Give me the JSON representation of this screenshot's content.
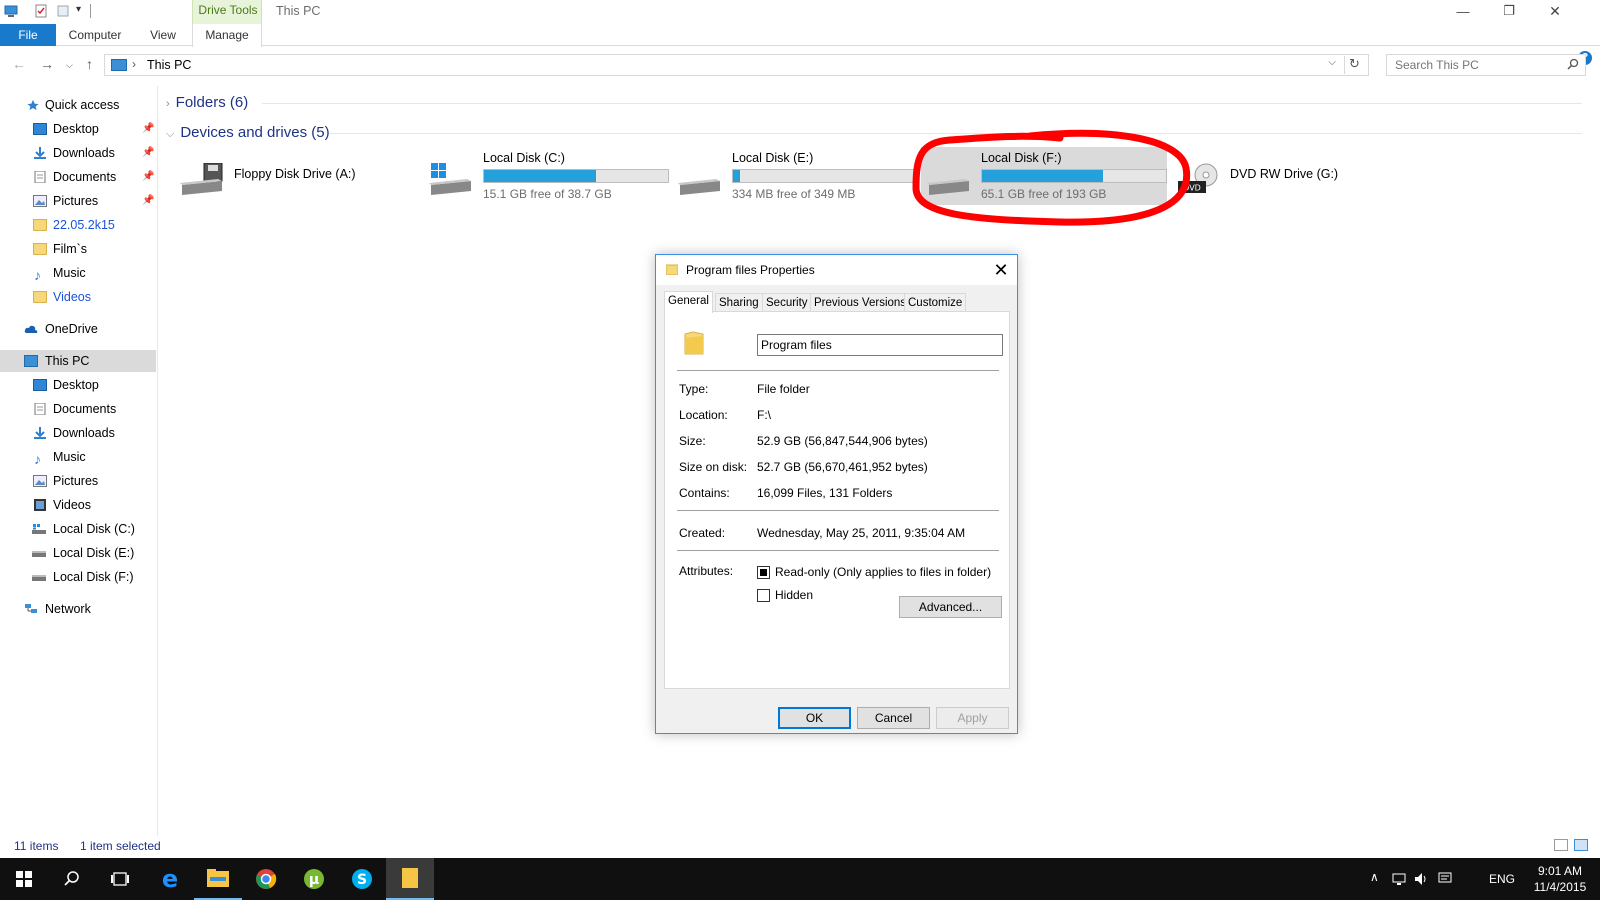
{
  "window": {
    "title": "This PC",
    "context_group": "Drive Tools",
    "minimize": "—",
    "restore": "❐",
    "close": "✕"
  },
  "ribbon": {
    "tabs": [
      "File",
      "Computer",
      "View",
      "Manage"
    ],
    "help": "?"
  },
  "address": {
    "path": "This PC",
    "search_placeholder": "Search This PC"
  },
  "nav": {
    "quick_access": "Quick access",
    "quick_items": [
      "Desktop",
      "Downloads",
      "Documents",
      "Pictures",
      "22.05.2k15",
      "Film`s",
      "Music",
      "Videos"
    ],
    "onedrive": "OneDrive",
    "this_pc": "This PC",
    "pc_items": [
      "Desktop",
      "Documents",
      "Downloads",
      "Music",
      "Pictures",
      "Videos",
      "Local Disk (C:)",
      "Local Disk (E:)",
      "Local Disk (F:)"
    ],
    "network": "Network"
  },
  "content": {
    "folders_header": "Folders (6)",
    "devices_header": "Devices and drives (5)",
    "drives": [
      {
        "name": "Floppy Disk Drive (A:)",
        "free": "",
        "used_fraction": null
      },
      {
        "name": "Local Disk (C:)",
        "free": "15.1 GB free of 38.7 GB",
        "used_fraction": 0.61
      },
      {
        "name": "Local Disk (E:)",
        "free": "334 MB free of 349 MB",
        "used_fraction": 0.04
      },
      {
        "name": "Local Disk (F:)",
        "free": "65.1 GB free of 193 GB",
        "used_fraction": 0.66
      },
      {
        "name": "DVD RW Drive (G:)",
        "free": "",
        "used_fraction": null
      }
    ]
  },
  "status": {
    "items": "11 items",
    "selected": "1 item selected"
  },
  "dialog": {
    "title": "Program files Properties",
    "close": "✕",
    "tabs": [
      "General",
      "Sharing",
      "Security",
      "Previous Versions",
      "Customize"
    ],
    "name": "Program files",
    "type_label": "Type:",
    "type_value": "File folder",
    "location_label": "Location:",
    "location_value": "F:\\",
    "size_label": "Size:",
    "size_value": "52.9 GB (56,847,544,906 bytes)",
    "size_on_disk_label": "Size on disk:",
    "size_on_disk_value": "52.7 GB (56,670,461,952 bytes)",
    "contains_label": "Contains:",
    "contains_value": "16,099 Files, 131 Folders",
    "created_label": "Created:",
    "created_value": "Wednesday, May 25, 2011, 9:35:04 AM",
    "attributes_label": "Attributes:",
    "readonly_label": "Read-only (Only applies to files in folder)",
    "readonly_checked": true,
    "hidden_label": "Hidden",
    "hidden_checked": false,
    "advanced_label": "Advanced...",
    "ok_label": "OK",
    "cancel_label": "Cancel",
    "apply_label": "Apply"
  },
  "taskbar": {
    "lang": "ENG",
    "time": "9:01 AM",
    "date": "11/4/2015"
  },
  "colors": {
    "accent": "#1979ca",
    "drive_bar": "#26a0da",
    "annotation": "#ff0000"
  }
}
